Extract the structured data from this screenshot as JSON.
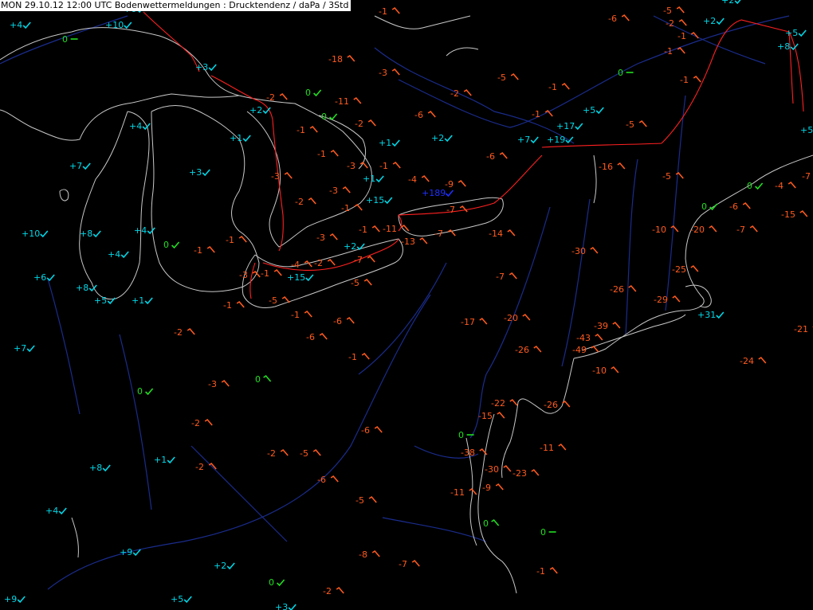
{
  "header": {
    "title": "MON 29.10.12 12:00 UTC  Bodenwettermeldungen :  Drucktendenz / daPa / 3Std"
  },
  "colors": {
    "background": "#000000",
    "rising": "#00d8e8",
    "falling": "#ff5a1e",
    "steady": "#21e021",
    "outlier": "#2030ff",
    "coast": "#c8c8c8",
    "rivers": "#1a2c8c",
    "borders": "#ff2020"
  },
  "observations": [
    {
      "v": "+4",
      "c": "up",
      "s": "up"
    },
    {
      "v": "+6",
      "c": "up",
      "s": "up"
    },
    {
      "v": "+10",
      "c": "up",
      "s": "up"
    },
    {
      "v": "0",
      "c": "steady",
      "s": "flat"
    },
    {
      "v": "+3",
      "c": "up",
      "s": "up"
    },
    {
      "v": "+2",
      "c": "up",
      "s": "up"
    },
    {
      "v": "0",
      "c": "steady",
      "s": "up"
    },
    {
      "v": "0",
      "c": "steady",
      "s": "up"
    },
    {
      "v": "+4",
      "c": "up",
      "s": "up"
    },
    {
      "v": "+1",
      "c": "up",
      "s": "up"
    },
    {
      "v": "+7",
      "c": "up",
      "s": "up"
    },
    {
      "v": "+3",
      "c": "up",
      "s": "up"
    },
    {
      "v": "+10",
      "c": "up",
      "s": "up"
    },
    {
      "v": "+8",
      "c": "up",
      "s": "up"
    },
    {
      "v": "+4",
      "c": "up",
      "s": "up"
    },
    {
      "v": "+4",
      "c": "up",
      "s": "up"
    },
    {
      "v": "0",
      "c": "steady",
      "s": "up"
    },
    {
      "v": "+6",
      "c": "up",
      "s": "up"
    },
    {
      "v": "+8",
      "c": "up",
      "s": "up"
    },
    {
      "v": "+5",
      "c": "up",
      "s": "up"
    },
    {
      "v": "+1",
      "c": "up",
      "s": "up"
    },
    {
      "v": "+7",
      "c": "up",
      "s": "up"
    },
    {
      "v": "0",
      "c": "steady",
      "s": "up"
    },
    {
      "v": "0",
      "c": "steady",
      "s": "down"
    },
    {
      "v": "+8",
      "c": "up",
      "s": "up"
    },
    {
      "v": "+1",
      "c": "up",
      "s": "up"
    },
    {
      "v": "+4",
      "c": "up",
      "s": "up"
    },
    {
      "v": "+9",
      "c": "up",
      "s": "up"
    },
    {
      "v": "+2",
      "c": "up",
      "s": "up"
    },
    {
      "v": "0",
      "c": "steady",
      "s": "up"
    },
    {
      "v": "+9",
      "c": "up",
      "s": "up"
    },
    {
      "v": "+5",
      "c": "up",
      "s": "up"
    },
    {
      "v": "+3",
      "c": "up",
      "s": "up"
    },
    {
      "v": "-2",
      "c": "down",
      "s": "down"
    },
    {
      "v": "-11",
      "c": "down",
      "s": "down"
    },
    {
      "v": "-2",
      "c": "down",
      "s": "down"
    },
    {
      "v": "-1",
      "c": "down",
      "s": "down"
    },
    {
      "v": "-1",
      "c": "down",
      "s": "down"
    },
    {
      "v": "-3",
      "c": "down",
      "s": "down"
    },
    {
      "v": "-1",
      "c": "down",
      "s": "down"
    },
    {
      "v": "+1",
      "c": "up",
      "s": "up"
    },
    {
      "v": "+1",
      "c": "up",
      "s": "up"
    },
    {
      "v": "-3",
      "c": "down",
      "s": "down"
    },
    {
      "v": "-2",
      "c": "down",
      "s": "down"
    },
    {
      "v": "-3",
      "c": "down",
      "s": "down"
    },
    {
      "v": "-1",
      "c": "down",
      "s": "down"
    },
    {
      "v": "-1",
      "c": "down",
      "s": "down"
    },
    {
      "v": "-1",
      "c": "down",
      "s": "down"
    },
    {
      "v": "-3",
      "c": "down",
      "s": "down"
    },
    {
      "v": "-3",
      "c": "down",
      "s": "down"
    },
    {
      "v": "-1",
      "c": "down",
      "s": "down"
    },
    {
      "v": "-4",
      "c": "down",
      "s": "down"
    },
    {
      "v": "-2",
      "c": "down",
      "s": "down"
    },
    {
      "v": "+15",
      "c": "up",
      "s": "up"
    },
    {
      "v": "-5",
      "c": "down",
      "s": "down"
    },
    {
      "v": "-1",
      "c": "down",
      "s": "down"
    },
    {
      "v": "-1",
      "c": "down",
      "s": "down"
    },
    {
      "v": "-1",
      "c": "down",
      "s": "down"
    },
    {
      "v": "+2",
      "c": "up",
      "s": "up"
    },
    {
      "v": "-7",
      "c": "down",
      "s": "down"
    },
    {
      "v": "-5",
      "c": "down",
      "s": "down"
    },
    {
      "v": "-6",
      "c": "down",
      "s": "down"
    },
    {
      "v": "-6",
      "c": "down",
      "s": "down"
    },
    {
      "v": "-1",
      "c": "down",
      "s": "down"
    },
    {
      "v": "-6",
      "c": "down",
      "s": "down"
    },
    {
      "v": "-2",
      "c": "down",
      "s": "down"
    },
    {
      "v": "-3",
      "c": "down",
      "s": "down"
    },
    {
      "v": "-2",
      "c": "down",
      "s": "down"
    },
    {
      "v": "-2",
      "c": "down",
      "s": "down"
    },
    {
      "v": "-2",
      "c": "down",
      "s": "down"
    },
    {
      "v": "-5",
      "c": "down",
      "s": "down"
    },
    {
      "v": "-6",
      "c": "down",
      "s": "down"
    },
    {
      "v": "-5",
      "c": "down",
      "s": "down"
    },
    {
      "v": "-8",
      "c": "down",
      "s": "down"
    },
    {
      "v": "-7",
      "c": "down",
      "s": "down"
    },
    {
      "v": "-2",
      "c": "down",
      "s": "down"
    },
    {
      "v": "-1",
      "c": "down",
      "s": "down"
    },
    {
      "v": "-18",
      "c": "down",
      "s": "down"
    },
    {
      "v": "-3",
      "c": "down",
      "s": "down"
    },
    {
      "v": "-5",
      "c": "down",
      "s": "down"
    },
    {
      "v": "-2",
      "c": "down",
      "s": "down"
    },
    {
      "v": "-1",
      "c": "down",
      "s": "down"
    },
    {
      "v": "-6",
      "c": "down",
      "s": "down"
    },
    {
      "v": "+2",
      "c": "up",
      "s": "up"
    },
    {
      "v": "-1",
      "c": "down",
      "s": "down"
    },
    {
      "v": "+17",
      "c": "up",
      "s": "up"
    },
    {
      "v": "+5",
      "c": "up",
      "s": "up"
    },
    {
      "v": "+7",
      "c": "up",
      "s": "up"
    },
    {
      "v": "+19",
      "c": "up",
      "s": "up"
    },
    {
      "v": "-4",
      "c": "down",
      "s": "down"
    },
    {
      "v": "+15",
      "c": "up",
      "s": "up"
    },
    {
      "v": "+189",
      "c": "outlier",
      "s": "up"
    },
    {
      "v": "-9",
      "c": "down",
      "s": "down"
    },
    {
      "v": "-7",
      "c": "down",
      "s": "down"
    },
    {
      "v": "-7",
      "c": "down",
      "s": "down"
    },
    {
      "v": "-14",
      "c": "down",
      "s": "down"
    },
    {
      "v": "-11",
      "c": "down",
      "s": "down"
    },
    {
      "v": "-13",
      "c": "down",
      "s": "down"
    },
    {
      "v": "-7",
      "c": "down",
      "s": "down"
    },
    {
      "v": "-17",
      "c": "down",
      "s": "down"
    },
    {
      "v": "-20",
      "c": "down",
      "s": "down"
    },
    {
      "v": "-26",
      "c": "down",
      "s": "down"
    },
    {
      "v": "-30",
      "c": "down",
      "s": "down"
    },
    {
      "v": "-16",
      "c": "down",
      "s": "down"
    },
    {
      "v": "-6",
      "c": "down",
      "s": "down"
    },
    {
      "v": "-6",
      "c": "down",
      "s": "down"
    },
    {
      "v": "-5",
      "c": "down",
      "s": "down"
    },
    {
      "v": "-2",
      "c": "down",
      "s": "down"
    },
    {
      "v": "-1",
      "c": "down",
      "s": "down"
    },
    {
      "v": "+2",
      "c": "up",
      "s": "up"
    },
    {
      "v": "+2",
      "c": "up",
      "s": "up"
    },
    {
      "v": "-1",
      "c": "down",
      "s": "down"
    },
    {
      "v": "-1",
      "c": "down",
      "s": "down"
    },
    {
      "v": "0",
      "c": "steady",
      "s": "flat"
    },
    {
      "v": "+5",
      "c": "up",
      "s": "up"
    },
    {
      "v": "+8",
      "c": "up",
      "s": "up"
    },
    {
      "v": "+5",
      "c": "up",
      "s": "up"
    },
    {
      "v": "-5",
      "c": "down",
      "s": "down"
    },
    {
      "v": "-5",
      "c": "down",
      "s": "down"
    },
    {
      "v": "-7",
      "c": "down",
      "s": "down"
    },
    {
      "v": "-6",
      "c": "down",
      "s": "down"
    },
    {
      "v": "0",
      "c": "steady",
      "s": "up"
    },
    {
      "v": "0",
      "c": "steady",
      "s": "up"
    },
    {
      "v": "-4",
      "c": "down",
      "s": "down"
    },
    {
      "v": "-15",
      "c": "down",
      "s": "down"
    },
    {
      "v": "-10",
      "c": "down",
      "s": "down"
    },
    {
      "v": "-20",
      "c": "down",
      "s": "down"
    },
    {
      "v": "-7",
      "c": "down",
      "s": "down"
    },
    {
      "v": "-25",
      "c": "down",
      "s": "down"
    },
    {
      "v": "-26",
      "c": "down",
      "s": "down"
    },
    {
      "v": "-29",
      "c": "down",
      "s": "down"
    },
    {
      "v": "+31",
      "c": "up",
      "s": "up"
    },
    {
      "v": "-21",
      "c": "down",
      "s": "down"
    },
    {
      "v": "-39",
      "c": "down",
      "s": "down"
    },
    {
      "v": "-43",
      "c": "down",
      "s": "down"
    },
    {
      "v": "-49",
      "c": "down",
      "s": "down"
    },
    {
      "v": "-10",
      "c": "down",
      "s": "down"
    },
    {
      "v": "-24",
      "c": "down",
      "s": "down"
    },
    {
      "v": "-26",
      "c": "down",
      "s": "down"
    },
    {
      "v": "-22",
      "c": "down",
      "s": "down"
    },
    {
      "v": "-15",
      "c": "down",
      "s": "down"
    },
    {
      "v": "0",
      "c": "steady",
      "s": "flat"
    },
    {
      "v": "-38",
      "c": "down",
      "s": "down"
    },
    {
      "v": "-11",
      "c": "down",
      "s": "down"
    },
    {
      "v": "-30",
      "c": "down",
      "s": "down"
    },
    {
      "v": "-23",
      "c": "down",
      "s": "down"
    },
    {
      "v": "-9",
      "c": "down",
      "s": "down"
    },
    {
      "v": "-11",
      "c": "down",
      "s": "down"
    },
    {
      "v": "0",
      "c": "steady",
      "s": "down"
    },
    {
      "v": "0",
      "c": "steady",
      "s": "flat"
    },
    {
      "v": "-1",
      "c": "down",
      "s": "down"
    }
  ]
}
